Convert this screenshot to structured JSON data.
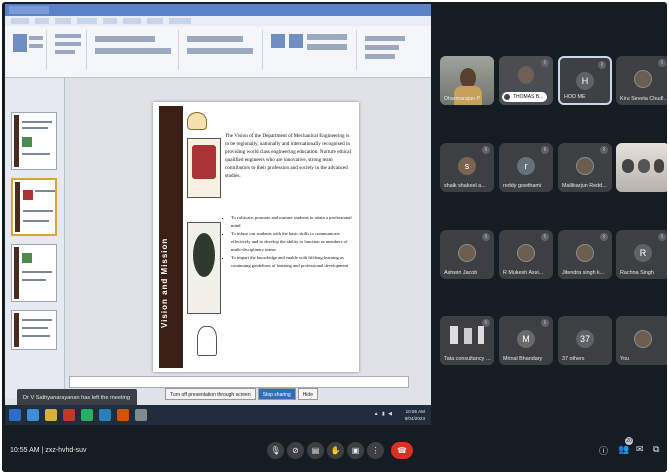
{
  "meeting": {
    "time": "10:55 AM",
    "separator": "|",
    "code": "zxz-hvhd-suv",
    "people_count": "20"
  },
  "toast": {
    "text": "Dr V Sathyanarayanan has left the meeting"
  },
  "slide": {
    "side_title": "Vision and Mission",
    "vision_text": "The Vision of the Department of Mechanical Engineering is to be regionally, nationally and internationally recognised in providing world class engineering education. Nurture ethical qualified engineers who are innovative, strong team contributors to their profession and society in the advanced studies.",
    "mission_items": [
      "To cultivate, promote and nurture students to attain a professional mind",
      "To infuse our students with the basic skills to communicate effectively and to develop the ability to function as members of multi-disciplinary teams",
      "To impart the knowledge and enable with lifelong learning as continuing guidelines of learning and professional development"
    ]
  },
  "screen_share": {
    "context_actions": [
      "Turn off presentation through screen",
      "Stop sharing",
      "Hide"
    ],
    "clock_time": "10:55 AM",
    "clock_date": "9/04/2023"
  },
  "participants": [
    {
      "name": "Dharmarajan P",
      "kind": "video",
      "muted": false
    },
    {
      "name": "THOMAS B...",
      "kind": "pill",
      "initial": "",
      "muted": true
    },
    {
      "name": "HOD ME",
      "kind": "avatar",
      "initial": "H",
      "color": "#5f6368",
      "muted": true,
      "active": true
    },
    {
      "name": "Kiru Seveta Chudl...",
      "kind": "photo",
      "initial": "",
      "muted": true
    },
    {
      "name": "shaik shakeel a...",
      "kind": "avatar",
      "initial": "s",
      "color": "#7a6450",
      "muted": true
    },
    {
      "name": "reddy gowthami",
      "kind": "avatar",
      "initial": "r",
      "color": "#65707a",
      "muted": true
    },
    {
      "name": "Mallikarjun Redd...",
      "kind": "photo",
      "initial": "",
      "muted": true
    },
    {
      "name": "",
      "kind": "video2",
      "muted": false
    },
    {
      "name": "Ashwin Jacob",
      "kind": "photo",
      "initial": "",
      "muted": true
    },
    {
      "name": "R Mukesh Assi...",
      "kind": "photo",
      "initial": "",
      "muted": true
    },
    {
      "name": "Jitendra singh k...",
      "kind": "photo",
      "initial": "",
      "muted": true
    },
    {
      "name": "Rachna Singh",
      "kind": "avatar",
      "initial": "R",
      "color": "#5f6368",
      "muted": true
    },
    {
      "name": "Tata consultancy services ...",
      "kind": "video3",
      "muted": true
    },
    {
      "name": "Mrinal Bhandary",
      "kind": "avatar",
      "initial": "M",
      "color": "#6a6a6a",
      "muted": true
    },
    {
      "name": "37 others",
      "kind": "avatar",
      "initial": "37",
      "color": "#5f6368",
      "muted": false
    },
    {
      "name": "You",
      "kind": "photo",
      "initial": "",
      "muted": false
    }
  ],
  "controls": [
    {
      "icon": "mic-icon",
      "glyph": "🎙"
    },
    {
      "icon": "camera-off-icon",
      "glyph": "⊘"
    },
    {
      "icon": "captions-icon",
      "glyph": "▤"
    },
    {
      "icon": "raise-hand-icon",
      "glyph": "✋"
    },
    {
      "icon": "present-icon",
      "glyph": "▣"
    },
    {
      "icon": "more-options-icon",
      "glyph": "⋮"
    },
    {
      "icon": "end-call-icon",
      "glyph": "☎"
    }
  ],
  "colors": {
    "background": "#151c22",
    "tile": "#3c4043",
    "end_call": "#d93025"
  }
}
